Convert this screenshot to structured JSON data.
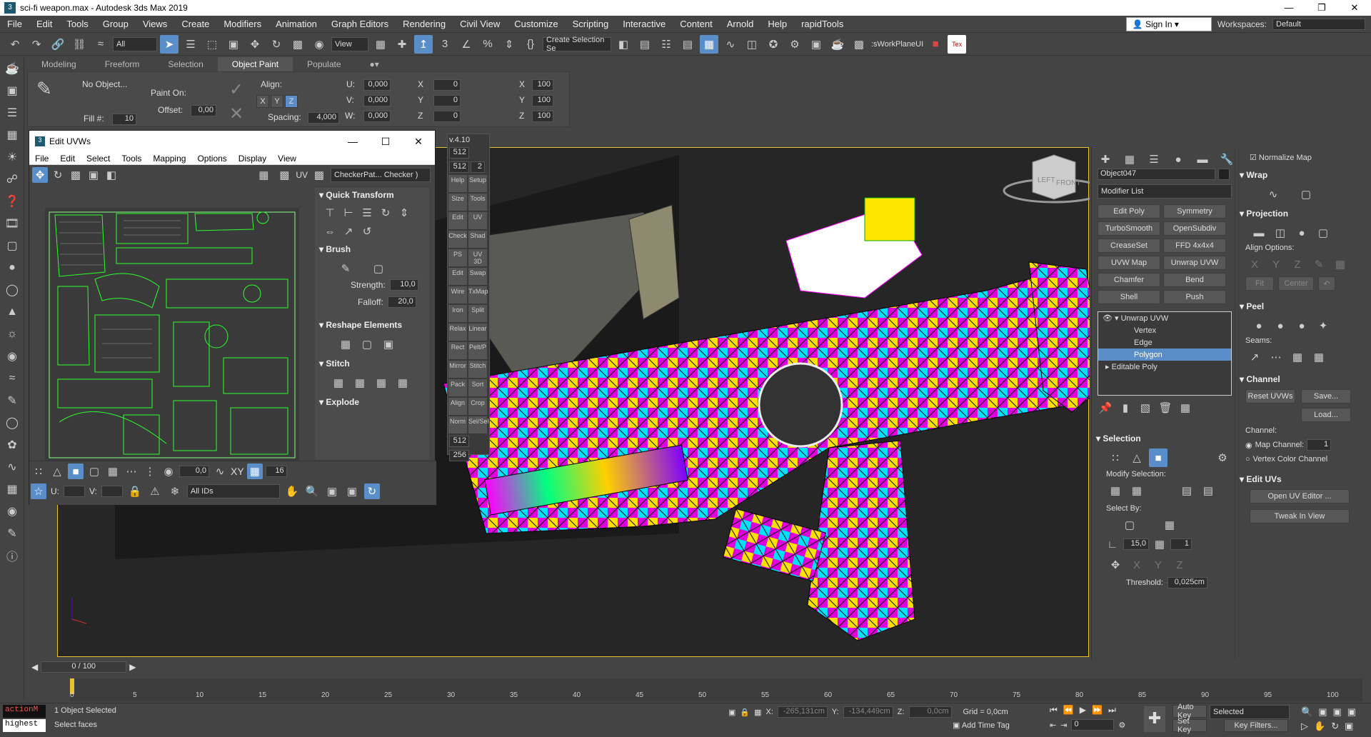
{
  "window": {
    "title": "sci-fi weapon.max - Autodesk 3ds Max 2019"
  },
  "menu": [
    "File",
    "Edit",
    "Tools",
    "Group",
    "Views",
    "Create",
    "Modifiers",
    "Animation",
    "Graph Editors",
    "Rendering",
    "Civil View",
    "Customize",
    "Scripting",
    "Interactive",
    "Content",
    "Arnold",
    "Help",
    "rapidTools"
  ],
  "signin": "Sign In",
  "workspaces_label": "Workspaces:",
  "workspace": "Default",
  "toolbar": {
    "filter": "All",
    "refcoord": "View",
    "selset": "Create Selection Se",
    "workplane": ":sWorkPlaneUI"
  },
  "ribbon": {
    "tabs": [
      "Modeling",
      "Freeform",
      "Selection",
      "Object Paint",
      "Populate"
    ],
    "no_object": "No Object...",
    "paint_on": "Paint On:",
    "offset_label": "Offset:",
    "offset_val": "0,00",
    "fill_label": "Fill #:",
    "fill_val": "10",
    "align_label": "Align:",
    "x": "X",
    "y": "Y",
    "z": "Z",
    "spacing_label": "Spacing:",
    "spacing_val": "4,000",
    "u_label": "U:",
    "u_val": "0,000",
    "v_label": "V:",
    "v_val": "0,000",
    "w_label": "W:",
    "w_val": "0,000",
    "rx_val": "0",
    "ry_val": "0",
    "rz_val": "0",
    "sx_val": "100",
    "sy_val": "100",
    "sz_val": "100"
  },
  "uvw": {
    "title": "Edit UVWs",
    "menu": [
      "File",
      "Edit",
      "Select",
      "Tools",
      "Mapping",
      "Options",
      "Display",
      "View"
    ],
    "uv_label": "UV",
    "checker": "CheckerPat... Checker )",
    "quick_transform": "Quick Transform",
    "brush": "Brush",
    "strength_label": "Strength:",
    "strength_val": "10,0",
    "falloff_label": "Falloff:",
    "falloff_val": "20,0",
    "reshape": "Reshape Elements",
    "stitch": "Stitch",
    "explode": "Explode",
    "xy": "XY",
    "grid_val": "16",
    "spin_val": "0,0",
    "u_label": "U:",
    "v_label": "V:",
    "ids": "All IDs"
  },
  "sidebar": {
    "version": "v.4.10",
    "size1": "512",
    "size2": "512",
    "count": "2",
    "tile1": "512",
    "tile2": "256",
    "cells": [
      "Help",
      "Setup",
      "Size",
      "Tools",
      "Edit",
      "UV",
      "Check",
      "Shad",
      "PS",
      "UV 3D",
      "Edit",
      "Swap",
      "Wire",
      "TxMap",
      "Iron",
      "Split",
      "Relax",
      "Linear",
      "Rect",
      "Pelt/P",
      "Mirror",
      "Stitch",
      "Pack",
      "Sort",
      "Align",
      "Crop",
      "Norm",
      "Sel/Sel"
    ]
  },
  "command": {
    "object_name": "Object047",
    "modifier_list": "Modifier List",
    "buttons": [
      "Edit Poly",
      "Symmetry",
      "TurboSmooth",
      "OpenSubdiv",
      "CreaseSet",
      "FFD 4x4x4",
      "UVW Map",
      "Unwrap UVW",
      "Chamfer",
      "Bend",
      "Shell",
      "Push"
    ],
    "stack": [
      "Unwrap UVW",
      "Vertex",
      "Edge",
      "Polygon",
      "Editable Poly"
    ],
    "selection": "Selection",
    "modify_selection": "Modify Selection:",
    "select_by": "Select By:",
    "angle_val": "15,0",
    "spin_val": "1",
    "threshold_label": "Threshold:",
    "threshold_val": "0,025cm",
    "normalize": "Normalize Map",
    "wrap": "Wrap",
    "projection": "Projection",
    "align_options": "Align Options:",
    "fit": "Fit",
    "center": "Center",
    "peel": "Peel",
    "seams": "Seams:",
    "channel": "Channel",
    "reset_uvws": "Reset UVWs",
    "save": "Save...",
    "load": "Load...",
    "channel_label": "Channel:",
    "map_channel": "Map Channel:",
    "map_channel_val": "1",
    "vertex_color": "Vertex Color Channel",
    "edit_uvs": "Edit UVs",
    "open_uv_editor": "Open UV Editor ...",
    "tweak": "Tweak In View"
  },
  "viewcube": {
    "left": "LEFT",
    "front": "FRONT"
  },
  "timeline": {
    "frame": "0 / 100",
    "ticks": [
      "0",
      "5",
      "10",
      "15",
      "20",
      "25",
      "30",
      "35",
      "40",
      "45",
      "50",
      "55",
      "60",
      "65",
      "70",
      "75",
      "80",
      "85",
      "90",
      "95",
      "100"
    ]
  },
  "status": {
    "script1": "actionM",
    "script2": "highest",
    "selected": "1 Object Selected",
    "prompt": "Select faces",
    "x_label": "X:",
    "x_val": "-265,131cm",
    "y_label": "Y:",
    "y_val": "-134,449cm",
    "z_label": "Z:",
    "z_val": "0,0cm",
    "grid": "Grid = 0,0cm",
    "add_time_tag": "Add Time Tag",
    "auto_key": "Auto Key",
    "set_key": "Set Key",
    "selected_dd": "Selected",
    "key_filters": "Key Filters...",
    "frame_val": "0"
  }
}
